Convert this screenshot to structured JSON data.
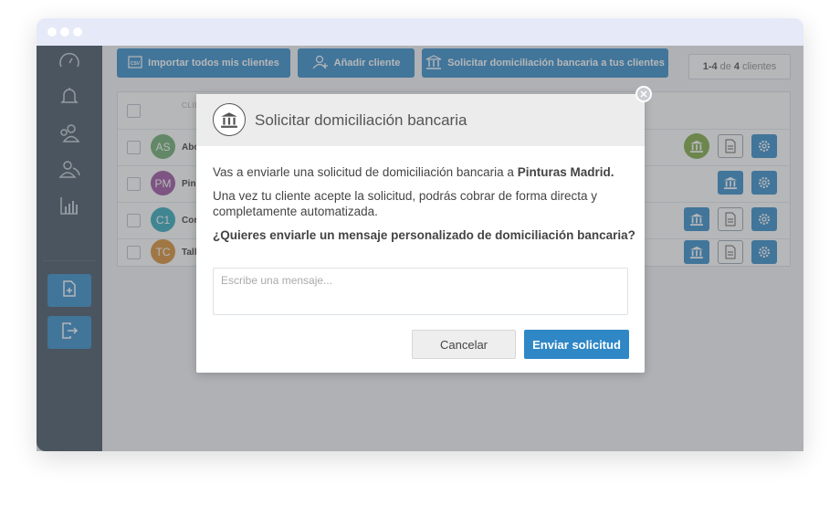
{
  "toolbar": {
    "import_label": "Importar todos mis clientes",
    "add_label": "Añadir cliente",
    "request_label": "Solicitar domiciliación bancaria a tus clientes"
  },
  "count": {
    "range": "1-4",
    "of": "de",
    "total": "4",
    "suffix": "clientes"
  },
  "table": {
    "header": "CLIENTE",
    "rows": [
      {
        "initials": "AS",
        "name": "Abc",
        "color": "#6aaa6a"
      },
      {
        "initials": "PM",
        "name": "Pin",
        "color": "#9a4b9c"
      },
      {
        "initials": "C1",
        "name": "Cor",
        "color": "#2aa6b8"
      },
      {
        "initials": "TC",
        "name": "Tall",
        "color": "#d98a2b"
      }
    ]
  },
  "modal": {
    "title": "Solicitar domiciliación bancaria",
    "line1_prefix": "Vas a enviarle una solicitud de domiciliación bancaria a ",
    "line1_client": "Pinturas Madrid.",
    "line2": "Una vez tu cliente acepte la solicitud, podrás  cobrar de forma directa y completamente automatizada.",
    "question": "¿Quieres enviarle un mensaje personalizado de domiciliación bancaria?",
    "message_placeholder": "Escribe una mensaje...",
    "cancel_label": "Cancelar",
    "send_label": "Enviar solicitud"
  },
  "icons": {
    "sidebar": [
      "dashboard-icon",
      "bell-icon",
      "users-icon",
      "user-group-icon",
      "chart-icon"
    ],
    "sidebar_buttons": [
      "new-document-icon",
      "logout-icon"
    ],
    "row_actions": [
      "bank-icon",
      "document-icon",
      "gear-icon"
    ]
  },
  "colors": {
    "accent": "#2f87c6",
    "sidebar": "#3f4d5b",
    "active_bank": "#7ba63a"
  }
}
